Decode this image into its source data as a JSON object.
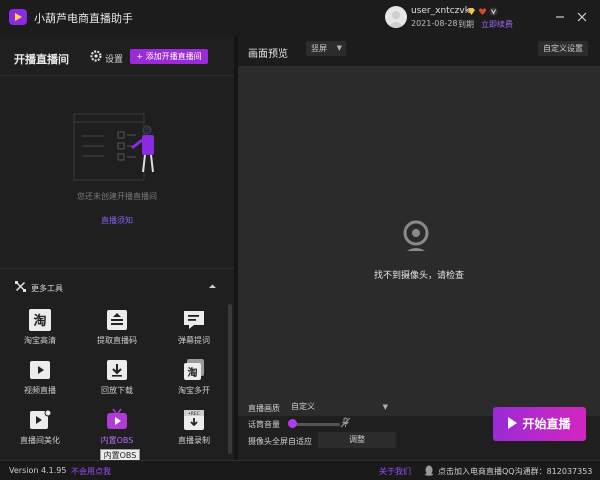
{
  "app": {
    "title": "小葫芦电商直播助手",
    "colors": {
      "accent": "#9b2bd6",
      "link": "#9b6cf5",
      "background": "#1f1f1f"
    }
  },
  "user": {
    "name": "user_xntczvk",
    "expire_date": "2021-08-28",
    "expire_word": "到期",
    "renew_label": "立即续费",
    "badges": [
      "diamond-icon",
      "heart-icon",
      "v-badge-icon"
    ]
  },
  "window_controls": [
    "minimize-icon",
    "close-icon"
  ],
  "left": {
    "title": "开播直播间",
    "settings_label": "设置",
    "add_button_label": "+ 添加开播直播间",
    "empty_text": "您还未创建开播直播间",
    "guide_link": "直播须知",
    "more_tools_label": "更多工具",
    "tools": [
      {
        "label": "淘宝高清",
        "icon": "taobao-icon"
      },
      {
        "label": "提取直播码",
        "icon": "stream-code-icon"
      },
      {
        "label": "弹幕提词",
        "icon": "barrage-prompt-icon"
      },
      {
        "label": "视频直播",
        "icon": "video-live-icon"
      },
      {
        "label": "回放下载",
        "icon": "replay-download-icon"
      },
      {
        "label": "淘宝多开",
        "icon": "taobao-multi-icon"
      },
      {
        "label": "直播间美化",
        "icon": "beautify-icon"
      },
      {
        "label": "内置OBS",
        "icon": "obs-icon"
      },
      {
        "label": "直播录制",
        "icon": "rec-icon"
      }
    ],
    "tooltip": "内置OBS"
  },
  "preview": {
    "title": "画面预览",
    "orientation": "竖屏",
    "custom_settings_label": "自定义设置",
    "no_camera_text": "找不到摄像头，请检查",
    "quality_label": "直播画质",
    "quality_value": "自定义",
    "volume_label": "话筒音量",
    "volume_level": 0.05,
    "fullscreen_label": "摄像头全屏自适应",
    "adjust_label": "调整",
    "start_label": "开始直播"
  },
  "status": {
    "version": "Version 4.1.95",
    "feedback": "不会用点我",
    "about": "关于我们",
    "qq_text": "点击加入电商直播QQ沟通群：812037353"
  }
}
